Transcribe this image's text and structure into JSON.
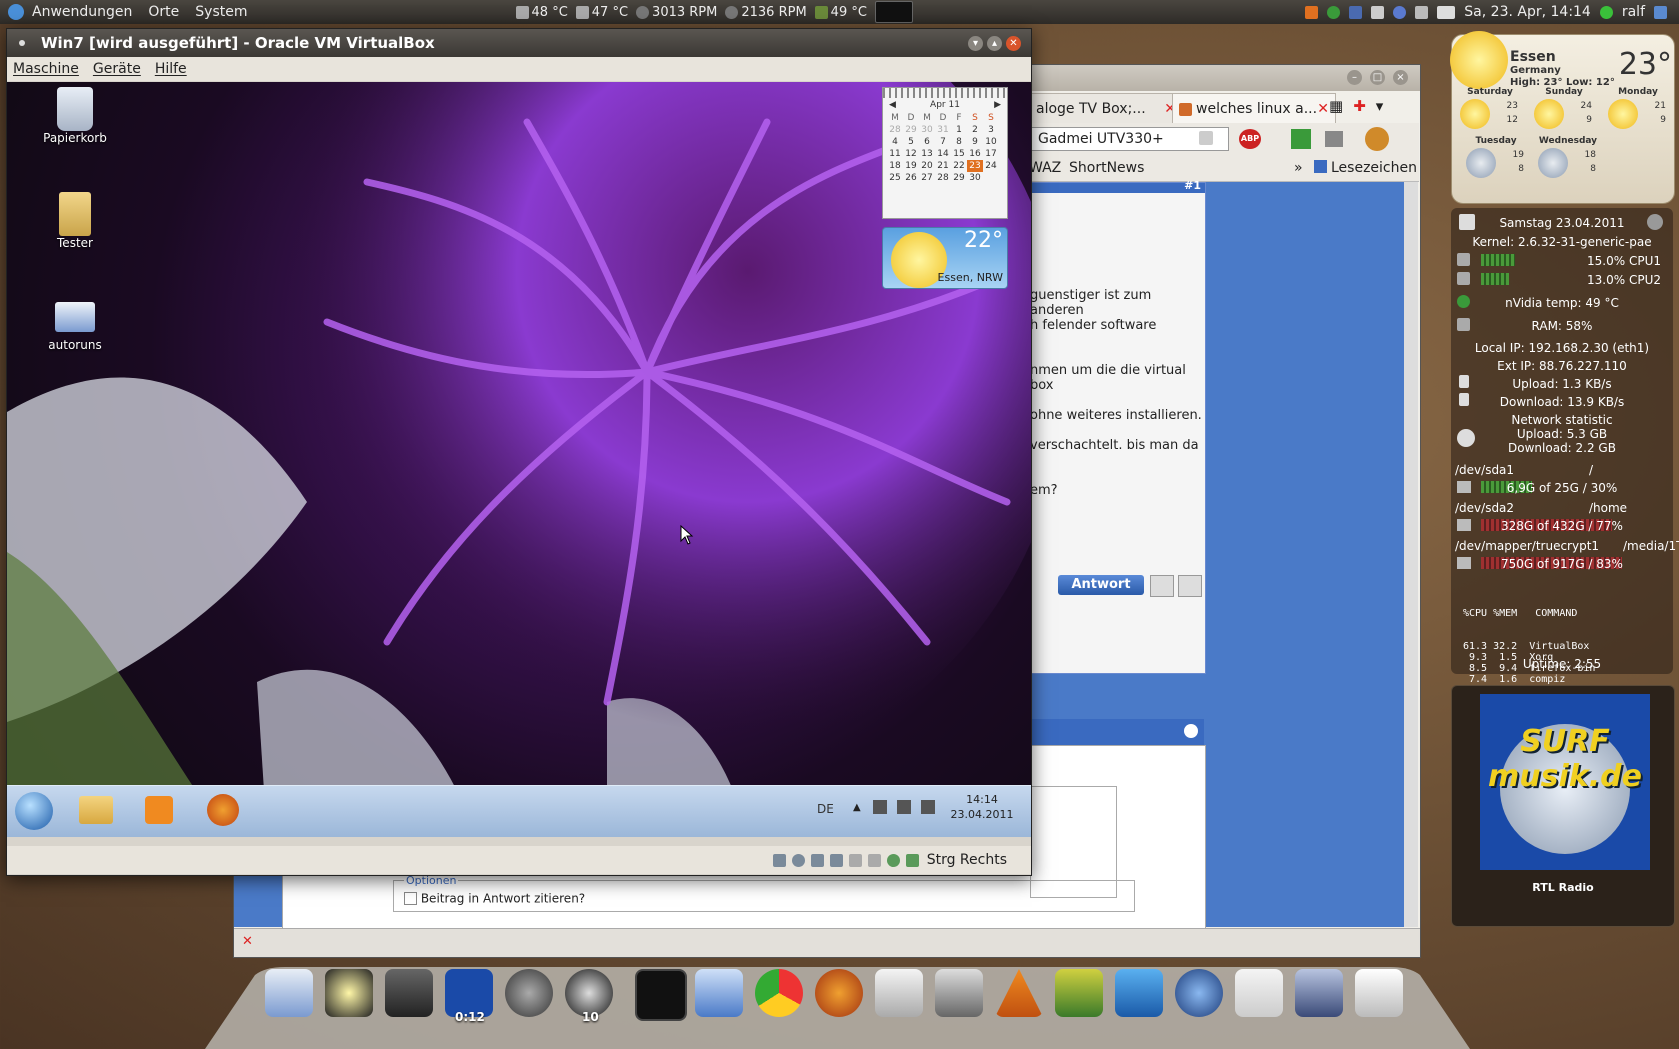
{
  "top_panel": {
    "menus": [
      "Anwendungen",
      "Orte",
      "System"
    ],
    "sensors": [
      "48 °C",
      "47 °C",
      "3013 RPM",
      "2136 RPM",
      "49 °C"
    ],
    "clock": "Sa, 23. Apr, 14:14",
    "user": "ralf"
  },
  "vbox": {
    "title": "Win7 [wird ausgeführt] - Oracle VM VirtualBox",
    "menus": [
      "Maschine",
      "Geräte",
      "Hilfe"
    ],
    "status_text": "Strg Rechts"
  },
  "guest": {
    "desktop_icons": [
      "Papierkorb",
      "Tester",
      "autoruns"
    ],
    "calendar": {
      "month": "Apr 11",
      "weekdays": [
        "M",
        "D",
        "M",
        "D",
        "F",
        "S",
        "S"
      ],
      "weeks": [
        [
          "28",
          "29",
          "30",
          "31",
          "1",
          "2",
          "3"
        ],
        [
          "4",
          "5",
          "6",
          "7",
          "8",
          "9",
          "10"
        ],
        [
          "11",
          "12",
          "13",
          "14",
          "15",
          "16",
          "17"
        ],
        [
          "18",
          "19",
          "20",
          "21",
          "22",
          "23",
          "24"
        ],
        [
          "25",
          "26",
          "27",
          "28",
          "29",
          "30",
          ""
        ]
      ]
    },
    "weather_gadget": {
      "temp": "22°",
      "place": "Essen, NRW"
    },
    "tray": {
      "lang": "DE",
      "time": "14:14",
      "date": "23.04.2011"
    }
  },
  "browser": {
    "tabs": [
      "aloge TV Box;...",
      "welches linux a..."
    ],
    "url": "Gadmei UTV330+",
    "bookmarks": [
      "WAZ",
      "ShortNews",
      "Lesezeichen"
    ],
    "post_lines": [
      "guenstiger ist zum anderen",
      "h felender software",
      "nmen um die die virtual box",
      "ohne weiteres installieren.",
      "verschachtelt. bis man da",
      "em?"
    ],
    "post_number": "#1",
    "reply_button": "Antwort",
    "options_legend": "Optionen",
    "quote_checkbox": "Beitrag in Antwort zitieren?"
  },
  "weather_widget": {
    "city": "Essen",
    "country": "Germany",
    "temp": "23°",
    "high_low": "High: 23°  Low: 12°",
    "forecast": [
      {
        "day": "Saturday",
        "hi": "23",
        "lo": "12"
      },
      {
        "day": "Sunday",
        "hi": "24",
        "lo": "9"
      },
      {
        "day": "Monday",
        "hi": "21",
        "lo": "9"
      },
      {
        "day": "Tuesday",
        "hi": "19",
        "lo": "8"
      },
      {
        "day": "Wednesday",
        "hi": "18",
        "lo": "8"
      }
    ]
  },
  "sysmon": {
    "date": "Samstag 23.04.2011",
    "kernel": "Kernel: 2.6.32-31-generic-pae",
    "cpu1": "15.0% CPU1",
    "cpu2": "13.0% CPU2",
    "gpu": "nVidia temp: 49 °C",
    "ram": "RAM: 58%",
    "local_ip": "Local IP: 192.168.2.30 (eth1)",
    "ext_ip": "Ext IP: 88.76.227.110",
    "upload": "Upload: 1.3 KB/s",
    "download": "Download: 13.9 KB/s",
    "net_title": "Network statistic",
    "net_up": "Upload: 5.3 GB",
    "net_down": "Download: 2.2 GB",
    "disks": [
      {
        "dev": "/dev/sda1",
        "mount": "/",
        "usage": "6,9G of 25G / 30%"
      },
      {
        "dev": "/dev/sda2",
        "mount": "/home",
        "usage": "328G of 432G / 77%"
      },
      {
        "dev": "/dev/mapper/truecrypt1",
        "mount": "/media/1TB",
        "usage": "750G of 917G / 83%"
      }
    ],
    "process_header": "%CPU %MEM   COMMAND",
    "processes": [
      "61.3 32.2  VirtualBox",
      " 9.3  1.5  Xorg",
      " 8.5  9.4  firefox-bin",
      " 7.4  1.6  compiz",
      " 6.2  1.6  rhythmbox"
    ],
    "uptime": "Uptime: 2:55"
  },
  "radio": {
    "logo_text": "SURF musik.de",
    "label": "RTL Radio"
  },
  "dock": {
    "badge1": "0:12",
    "badge2": "10"
  }
}
